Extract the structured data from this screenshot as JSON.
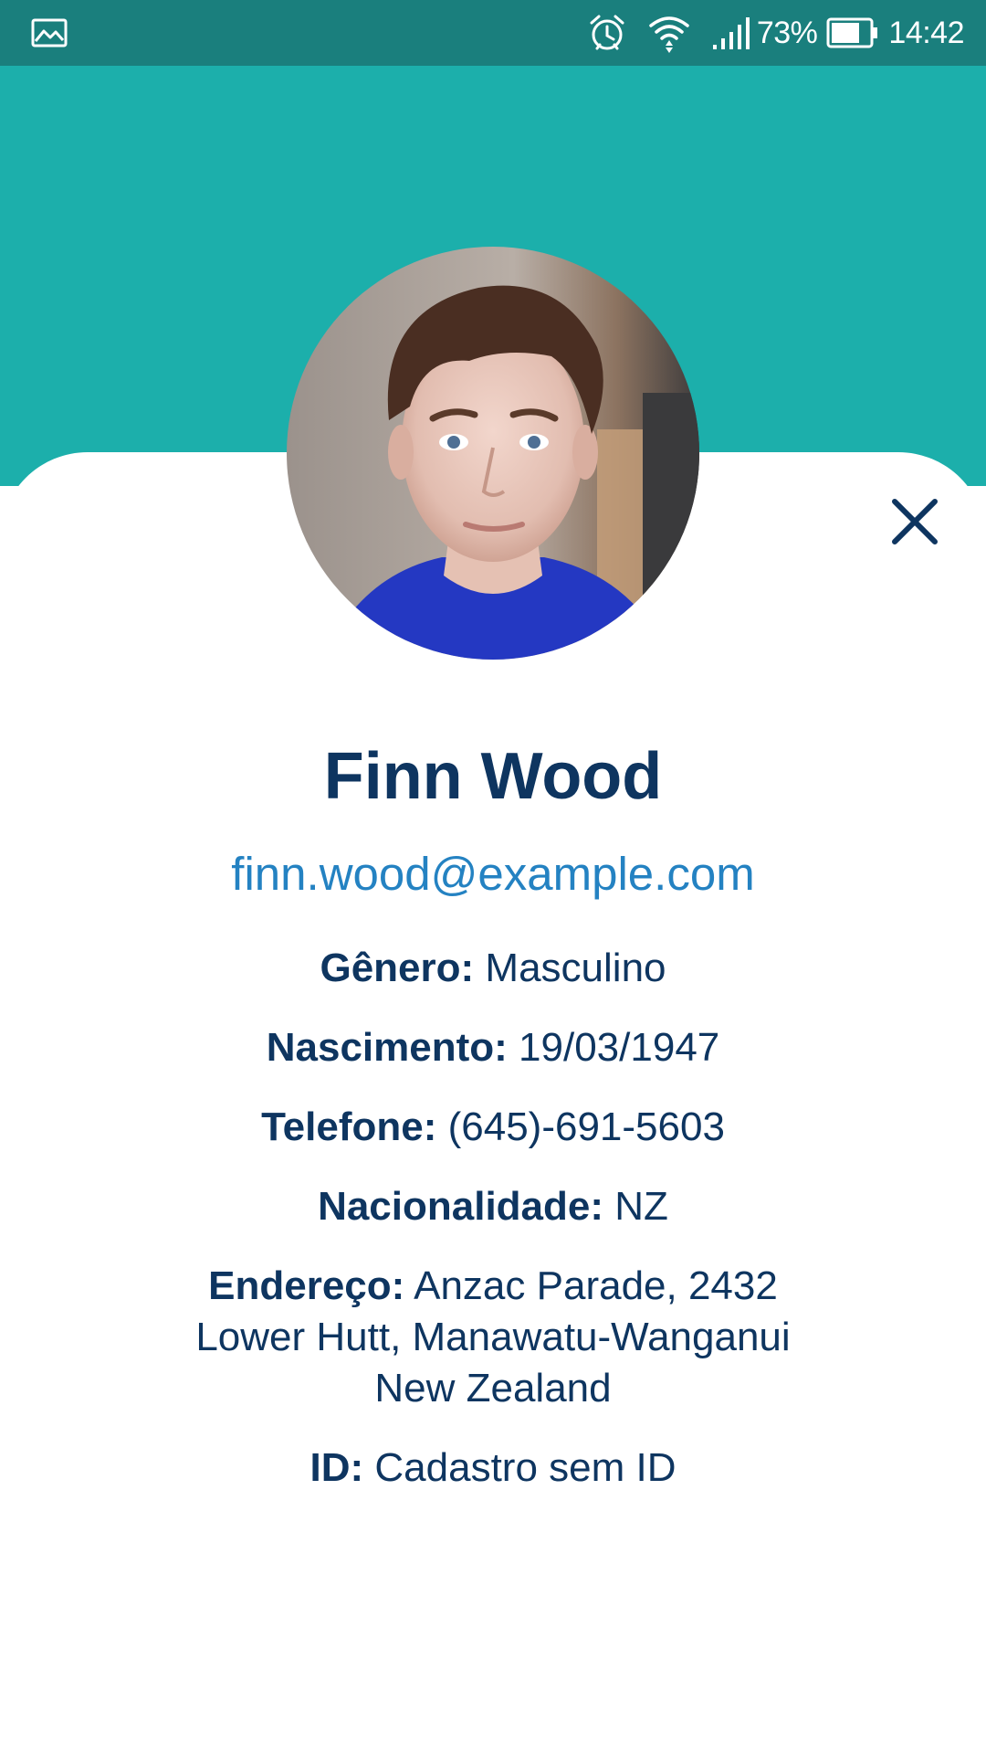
{
  "status_bar": {
    "battery_percent": "73%",
    "time": "14:42",
    "icons": [
      "gallery-icon",
      "alarm-icon",
      "wifi-icon",
      "signal-icon",
      "battery-icon"
    ],
    "background": "#1a7f7d"
  },
  "header": {
    "background": "#1cafab"
  },
  "profile": {
    "name": "Finn Wood",
    "email": "finn.wood@example.com",
    "fields": {
      "gender": {
        "label": "Gênero:",
        "value": "Masculino"
      },
      "birth": {
        "label": "Nascimento:",
        "value": "19/03/1947"
      },
      "phone": {
        "label": "Telefone:",
        "value": "(645)-691-5603"
      },
      "nationality": {
        "label": "Nacionalidade:",
        "value": "NZ"
      },
      "address": {
        "label": "Endereço:",
        "line1": "Anzac Parade, 2432",
        "line2": "Lower Hutt, Manawatu-Wanganui",
        "line3": "New Zealand"
      },
      "id": {
        "label": "ID:",
        "value": "Cadastro sem ID"
      }
    }
  },
  "colors": {
    "primary_text": "#0e3560",
    "email_link": "#2482c2",
    "accent": "#1cafab"
  }
}
